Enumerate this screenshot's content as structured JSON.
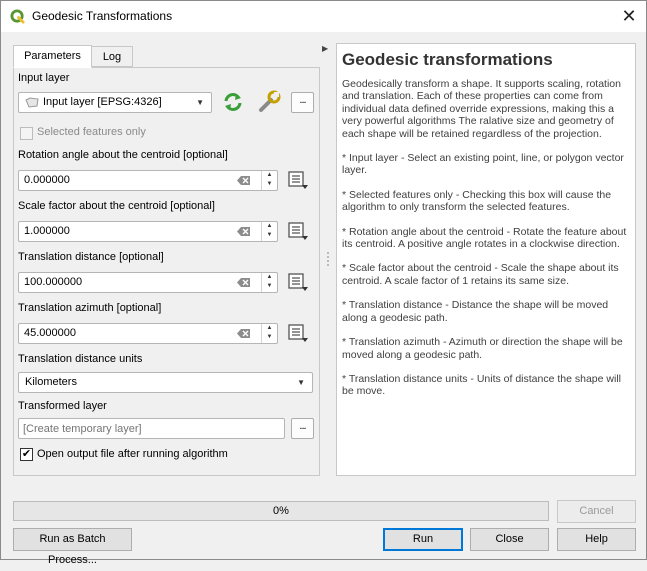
{
  "window": {
    "title": "Geodesic Transformations",
    "icon": "qgis-logo-icon",
    "close_glyph": "✕"
  },
  "tabs": [
    {
      "label": "Parameters",
      "active": true
    },
    {
      "label": "Log",
      "active": false
    }
  ],
  "parameters": {
    "input_layer": {
      "label": "Input layer",
      "value": "Input layer [EPSG:4326]"
    },
    "selected_only": {
      "label": "Selected features only",
      "checked": false,
      "enabled": false
    },
    "rotation": {
      "label": "Rotation angle about the centroid [optional]",
      "value": "0.000000"
    },
    "scale": {
      "label": "Scale factor about the centroid [optional]",
      "value": "1.000000"
    },
    "distance": {
      "label": "Translation distance [optional]",
      "value": "100.000000"
    },
    "azimuth": {
      "label": "Translation azimuth [optional]",
      "value": "45.000000"
    },
    "units": {
      "label": "Translation distance units",
      "value": "Kilometers"
    },
    "output": {
      "label": "Transformed layer",
      "placeholder": "[Create temporary layer]"
    },
    "open_output": {
      "label": "Open output file after running algorithm",
      "checked": true
    },
    "dots_label": "...",
    "check_glyph": "✔"
  },
  "help": {
    "title": "Geodesic transformations",
    "paragraphs": [
      "Geodesically transform a shape. It supports scaling, rotation and translation. Each of these properties can come from individual data defined override expressions, making this a very powerful algorithms The ralative size and geometry of each shape will be retained regardless of the projection.",
      "* Input layer - Select an existing point, line, or polygon vector layer.",
      "* Selected features only - Checking this box will cause the algorithm to only transform the selected features.",
      "* Rotation angle about the centroid - Rotate the feature about its centroid. A positive angle rotates in a clockwise direction.",
      "* Scale factor about the centroid - Scale the shape about its centroid. A scale factor of 1 retains its same size.",
      "* Translation distance - Distance the shape will be moved along a geodesic path.",
      "* Translation azimuth - Azimuth or direction the shape will be moved along a geodesic path.",
      "* Translation distance units - Units of distance the shape will be move."
    ]
  },
  "footer": {
    "progress_text": "0%",
    "progress": 0,
    "cancel_label": "Cancel",
    "batch_label": "Run as Batch Process...",
    "run_label": "Run",
    "close_label": "Close",
    "help_label": "Help"
  },
  "colors": {
    "accent": "#0078d7",
    "qgis_green": "#589632",
    "qgis_yellow": "#eebe2c"
  }
}
